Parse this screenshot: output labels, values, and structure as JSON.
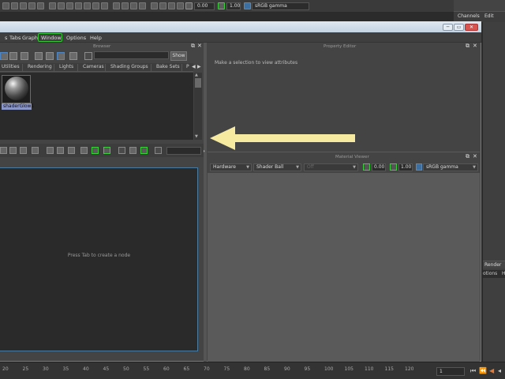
{
  "main": {
    "toolbar": {
      "exposure_value": "0.00",
      "gamma_value": "1.00",
      "color_space": "sRGB gamma"
    },
    "right_menu": {
      "channels": "Channels",
      "edit": "Edit"
    },
    "render_label": "Render",
    "right_tabs": {
      "left": "otions",
      "right": "H"
    },
    "timeline": {
      "ticks": [
        "20",
        "25",
        "30",
        "35",
        "40",
        "45",
        "50",
        "55",
        "60",
        "65",
        "70",
        "75",
        "80",
        "85",
        "90",
        "95",
        "100",
        "105",
        "110",
        "115",
        "120"
      ],
      "current_frame": "1"
    }
  },
  "hypershade": {
    "menubar": [
      "s",
      "Tabs",
      "Graph",
      "Window",
      "Options",
      "Help"
    ],
    "highlighted_menu": "Window",
    "browser": {
      "title": "Browser",
      "show_button": "Show",
      "tabs": [
        "Utilities",
        "Rendering",
        "Lights",
        "Cameras",
        "Shading Groups",
        "Bake Sets",
        "P"
      ],
      "swatches": [
        {
          "label": "shaderGlow1"
        }
      ]
    },
    "property_editor": {
      "title": "Property Editor",
      "message": "Make a selection to view attributes"
    },
    "material_viewer": {
      "title": "Material Viewer",
      "renderer": "Hardware",
      "shape": "Shader Ball",
      "env": "Off",
      "exposure": "0.00",
      "gamma": "1.00",
      "color_space": "sRGB gamma"
    },
    "work_area": {
      "hint": "Press Tab to create a node"
    }
  },
  "annotation": {
    "arrow_color": "#f5eaa0"
  },
  "colors": {
    "highlight_green": "#34c734",
    "swatch_label_bg": "#8a95c8",
    "titlebar": "#c4d3e2"
  }
}
